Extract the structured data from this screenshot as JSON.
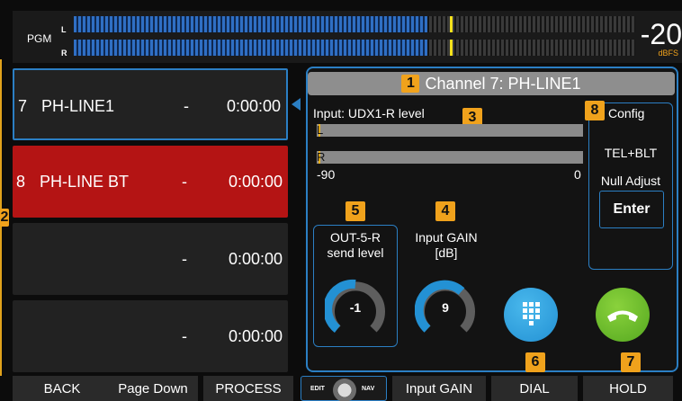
{
  "meter": {
    "label": "PGM",
    "left_label": "L",
    "right_label": "R",
    "value": "-20",
    "unit": "dBFS",
    "fill_fraction": 0.63,
    "peak_fraction": 0.67
  },
  "channels": [
    {
      "num": "7",
      "name": "PH-LINE1",
      "dash": "-",
      "time": "0:00:00",
      "state": "selected"
    },
    {
      "num": "8",
      "name": "PH-LINE BT",
      "dash": "-",
      "time": "0:00:00",
      "state": "active"
    },
    {
      "num": "",
      "name": "",
      "dash": "-",
      "time": "0:00:00",
      "state": "empty"
    },
    {
      "num": "",
      "name": "",
      "dash": "-",
      "time": "0:00:00",
      "state": "empty"
    }
  ],
  "panel": {
    "title": "Channel 7: PH-LINE1",
    "input_label": "Input: UDX1-R level",
    "level_left": "L",
    "level_right": "R",
    "scale_min": "-90",
    "scale_max": "0",
    "config": {
      "title": "Config",
      "tel": "TEL+BLT",
      "null_adjust": "Null Adjust",
      "enter": "Enter"
    },
    "out_label_1": "OUT-5-R",
    "out_label_2": "send level",
    "gain_label_1": "Input GAIN",
    "gain_label_2": "[dB]",
    "knob_out_value": "-1",
    "knob_gain_value": "9"
  },
  "badges": {
    "b1": "1",
    "b2": "2",
    "b3": "3",
    "b4": "4",
    "b5": "5",
    "b6": "6",
    "b7": "7",
    "b8": "8"
  },
  "bottom": {
    "back": "BACK",
    "page_down": "Page Down",
    "process": "PROCESS",
    "edit": "EDIT",
    "nav": "NAV",
    "input_gain": "Input GAIN",
    "dial": "DIAL",
    "hold": "HOLD"
  },
  "colors": {
    "accent_blue": "#2b7fc4",
    "badge_orange": "#f0a21c",
    "active_red": "#b41414",
    "dial_blue": "#2391d4",
    "hold_green": "#55a820"
  }
}
